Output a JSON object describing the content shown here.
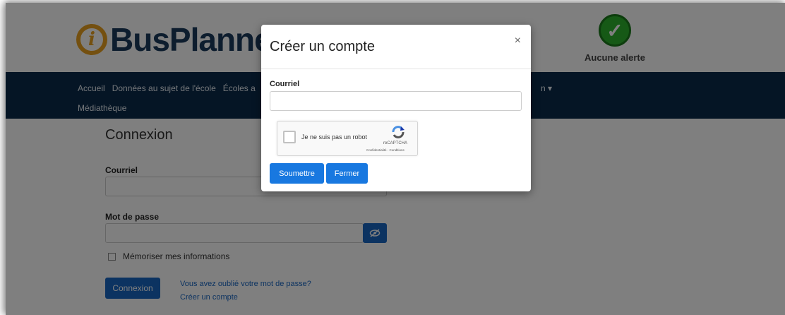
{
  "header": {
    "logo_letter": "i",
    "logo_text": "BusPlanner",
    "alert_label": "Aucune alerte"
  },
  "nav": {
    "items": [
      "Accueil",
      "Données au sujet de l'école",
      "Écoles a"
    ],
    "right_fragment": "n ▾",
    "row2": "Médiathèque"
  },
  "login": {
    "title": "Connexion",
    "email_label": "Courriel",
    "password_label": "Mot de passe",
    "remember_label": "Mémoriser mes informations",
    "submit_label": "Connexion",
    "forgot_link": "Vous avez oublié votre mot de passe?",
    "create_link": "Créer un compte"
  },
  "modal": {
    "title": "Créer un compte",
    "close_symbol": "×",
    "email_label": "Courriel",
    "email_value": "",
    "recaptcha_label": "Je ne suis pas un robot",
    "recaptcha_brand": "reCAPTCHA",
    "recaptcha_terms": "Confidentialité - Conditions",
    "submit_label": "Soumettre",
    "close_label": "Fermer"
  },
  "colors": {
    "navbar": "#0a2a4a",
    "primary_button": "#1878e0",
    "logo_accent": "#e8a020",
    "alert_ok": "#2db32d"
  },
  "icons": [
    "check-icon",
    "close-icon",
    "eye-slash-icon",
    "recaptcha-icon"
  ]
}
